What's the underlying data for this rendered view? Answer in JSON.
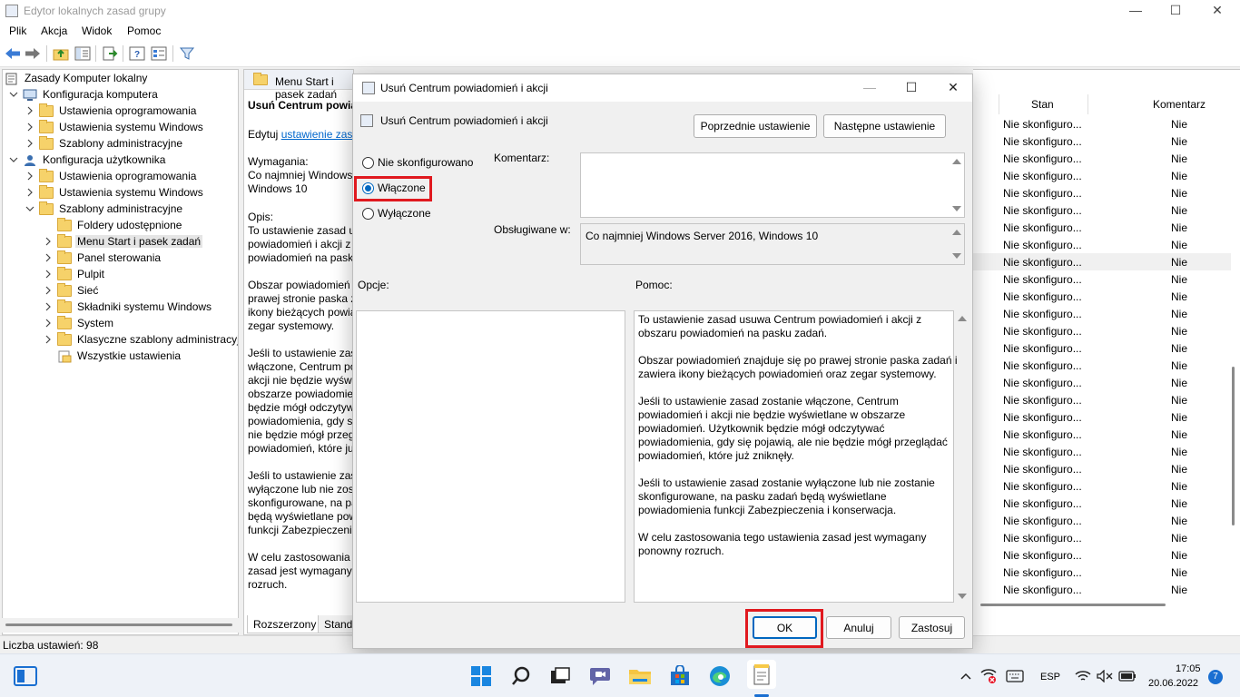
{
  "window": {
    "title": "Edytor lokalnych zasad grupy",
    "minimize": "—",
    "maximize": "☐",
    "close": "✕"
  },
  "menu": [
    "Plik",
    "Akcja",
    "Widok",
    "Pomoc"
  ],
  "tree": [
    {
      "label": "Zasady Komputer lokalny",
      "level": 0,
      "chevron": "",
      "icon": "policy"
    },
    {
      "label": "Konfiguracja komputera",
      "level": 0,
      "chevron": "v",
      "icon": "computer"
    },
    {
      "label": "Ustawienia oprogramowania",
      "level": 1,
      "chevron": ">",
      "icon": "folder"
    },
    {
      "label": "Ustawienia systemu Windows",
      "level": 1,
      "chevron": ">",
      "icon": "folder"
    },
    {
      "label": "Szablony administracyjne",
      "level": 1,
      "chevron": ">",
      "icon": "folder"
    },
    {
      "label": "Konfiguracja użytkownika",
      "level": 0,
      "chevron": "v",
      "icon": "user"
    },
    {
      "label": "Ustawienia oprogramowania",
      "level": 1,
      "chevron": ">",
      "icon": "folder"
    },
    {
      "label": "Ustawienia systemu Windows",
      "level": 1,
      "chevron": ">",
      "icon": "folder"
    },
    {
      "label": "Szablony administracyjne",
      "level": 1,
      "chevron": "v",
      "icon": "folder"
    },
    {
      "label": "Foldery udostępnione",
      "level": 2,
      "chevron": "",
      "icon": "folder"
    },
    {
      "label": "Menu Start i pasek zadań",
      "level": 2,
      "chevron": ">",
      "icon": "folder",
      "selected": true
    },
    {
      "label": "Panel sterowania",
      "level": 2,
      "chevron": ">",
      "icon": "folder"
    },
    {
      "label": "Pulpit",
      "level": 2,
      "chevron": ">",
      "icon": "folder"
    },
    {
      "label": "Sieć",
      "level": 2,
      "chevron": ">",
      "icon": "folder"
    },
    {
      "label": "Składniki systemu Windows",
      "level": 2,
      "chevron": ">",
      "icon": "folder"
    },
    {
      "label": "System",
      "level": 2,
      "chevron": ">",
      "icon": "folder"
    },
    {
      "label": "Klasyczne szablony administracyjne",
      "level": 2,
      "chevron": ">",
      "icon": "folder"
    },
    {
      "label": "Wszystkie ustawienia",
      "level": 2,
      "chevron": "",
      "icon": "settings"
    }
  ],
  "desc_pane": {
    "header": "Menu Start i pasek zadań",
    "policy_title": "Usuń Centrum powiadomień i akcji",
    "edit_prefix": "Edytuj ",
    "edit_link": "ustawienie zasad",
    "requirements": "Wymagania:\nCo najmniej Windows Server 2016,\nWindows 10",
    "description": "Opis:\nTo ustawienie zasad usuwa Centrum\npowiadomień i akcji z obszaru\npowiadomień na pasku zadań.\n\nObszar powiadomień znajduje się po\nprawej stronie paska zadań i zawiera\nikony bieżących powiadomień oraz\nzegar systemowy.\n\nJeśli to ustawienie zasad zostanie\nwłączone, Centrum powiadomień i\nakcji nie będzie wyświetlane w\nobszarze powiadomień. Użytkownik\nbędzie mógł odczytywać\npowiadomienia, gdy się pojawią, ale\nnie będzie mógł przeglądać\npowiadomień, które już zniknęły.\n\nJeśli to ustawienie zasad zostanie\nwyłączone lub nie zostanie\nskonfigurowane, na pasku zadań\nbędą wyświetlane powiadomienia\nfunkcji Zabezpieczenia i konserwacja.\n\nW celu zastosowania tego ustawienia\nzasad jest wymagany ponowny\nrozruch.",
    "tab_extended": "Rozszerzony",
    "tab_standard": "Standardowy"
  },
  "list": {
    "col_state": "Stan",
    "col_comment": "Komentarz",
    "rows_state": "Nie skonfiguro...",
    "rows_comment": "Nie",
    "row_count": 28,
    "selected_row": 8
  },
  "status": "Liczba ustawień: 98",
  "dialog": {
    "title": "Usuń Centrum powiadomień i akcji",
    "policy_name": "Usuń Centrum powiadomień i akcji",
    "prev_button": "Poprzednie ustawienie",
    "next_button": "Następne ustawienie",
    "radio_not_configured": "Nie skonfigurowano",
    "radio_enabled": "Włączone",
    "radio_disabled": "Wyłączone",
    "selected_option": "Włączone",
    "comment_label": "Komentarz:",
    "supported_label": "Obsługiwane w:",
    "supported_value": "Co najmniej Windows Server 2016, Windows 10",
    "options_label": "Opcje:",
    "help_label": "Pomoc:",
    "help_text": "To ustawienie zasad usuwa Centrum powiadomień i akcji z\nobszaru powiadomień na pasku zadań.\n\nObszar powiadomień znajduje się po prawej stronie paska zadań i\nzawiera ikony bieżących powiadomień oraz zegar systemowy.\n\nJeśli to ustawienie zasad zostanie włączone, Centrum\npowiadomień i akcji nie będzie wyświetlane w obszarze\npowiadomień. Użytkownik będzie mógł odczytywać\npowiadomienia, gdy się pojawią, ale nie będzie mógł przeglądać\npowiadomień, które już zniknęły.\n\nJeśli to ustawienie zasad zostanie wyłączone lub nie zostanie\nskonfigurowane, na pasku zadań będą wyświetlane\npowiadomienia funkcji Zabezpieczenia i konserwacja.\n\nW celu zastosowania tego ustawienia zasad jest wymagany\nponowny rozruch.",
    "ok": "OK",
    "cancel": "Anuluj",
    "apply": "Zastosuj",
    "highlight_color": "#e0191f"
  },
  "taskbar": {
    "lang": "ESP",
    "time": "17:05",
    "date": "20.06.2022",
    "notifications": "7"
  }
}
